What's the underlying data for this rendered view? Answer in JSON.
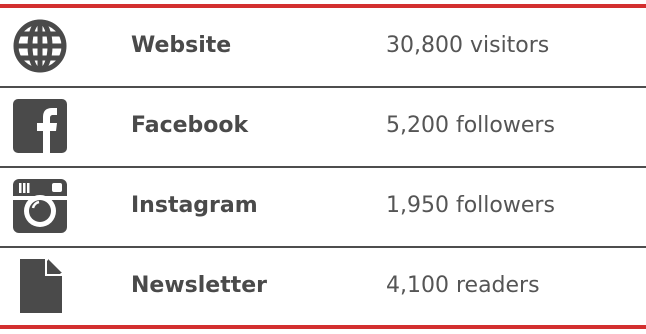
{
  "channels": [
    {
      "name": "Website",
      "value": "30,800 visitors",
      "icon": "globe-icon"
    },
    {
      "name": "Facebook",
      "value": "5,200 followers",
      "icon": "facebook-icon"
    },
    {
      "name": "Instagram",
      "value": "1,950 followers",
      "icon": "instagram-icon"
    },
    {
      "name": "Newsletter",
      "value": "4,100 readers",
      "icon": "document-icon"
    }
  ],
  "colors": {
    "accent": "#d32f2f",
    "icon": "#4a4a4a",
    "text": "#4a4a4a"
  }
}
